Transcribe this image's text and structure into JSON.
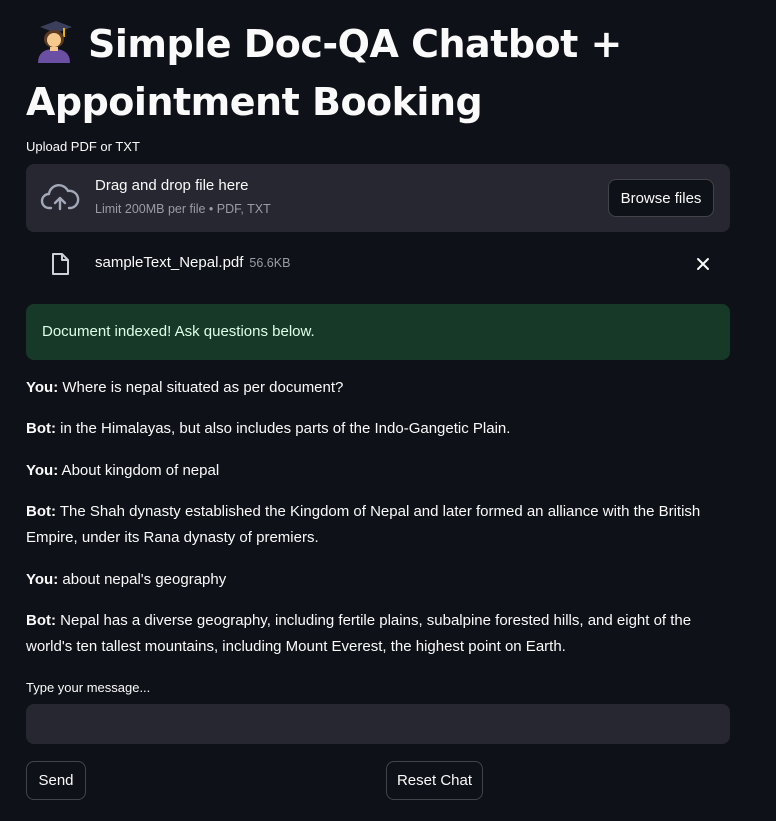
{
  "header": {
    "title_line1": "Simple Doc-QA Chatbot +",
    "title_line2": "Appointment Booking",
    "emoji_icon": "student-emoji-icon"
  },
  "upload": {
    "label": "Upload PDF or TXT",
    "dropzone_title": "Drag and drop file here",
    "dropzone_limits": "Limit 200MB per file • PDF, TXT",
    "browse_label": "Browse files",
    "file_name": "sampleText_Nepal.pdf",
    "file_size": "56.6KB"
  },
  "status": {
    "message": "Document indexed! Ask questions below.",
    "color": "#173928"
  },
  "chat": [
    {
      "speaker": "You:",
      "text": " Where is nepal situated as per document?"
    },
    {
      "speaker": "Bot:",
      "text": " in the Himalayas, but also includes parts of the Indo-Gangetic Plain."
    },
    {
      "speaker": "You:",
      "text": " About kingdom of nepal"
    },
    {
      "speaker": "Bot:",
      "text": " The Shah dynasty established the Kingdom of Nepal and later formed an alliance with the British Empire, under its Rana dynasty of premiers."
    },
    {
      "speaker": "You:",
      "text": " about nepal's geography"
    },
    {
      "speaker": "Bot:",
      "text": " Nepal has a diverse geography, including fertile plains, subalpine forested hills, and eight of the world's ten tallest mountains, including Mount Everest, the highest point on Earth."
    }
  ],
  "input": {
    "label": "Type your message...",
    "value": ""
  },
  "actions": {
    "send_label": "Send",
    "reset_label": "Reset Chat"
  },
  "theme": {
    "background": "#0e1117",
    "surface": "#262730",
    "text": "#fafafa"
  }
}
